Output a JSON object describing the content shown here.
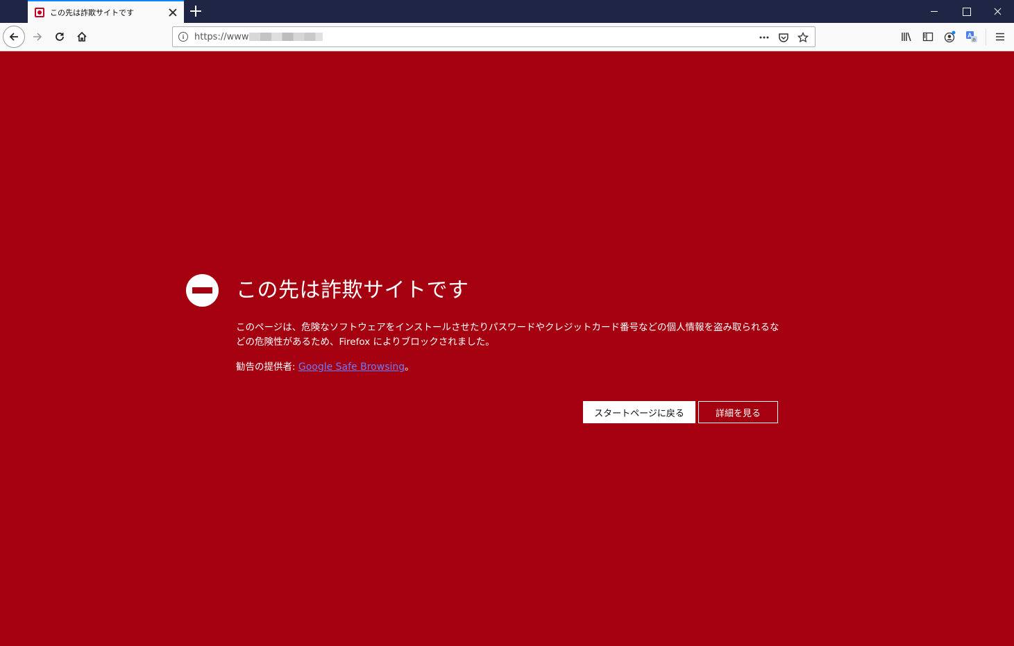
{
  "tab": {
    "title": "この先は詐欺サイトです"
  },
  "urlbar": {
    "url_visible": "https://www"
  },
  "warning": {
    "title": "この先は詐欺サイトです",
    "body": "このページは、危険なソフトウェアをインストールさせたりパスワードやクレジットカード番号などの個人情報を盗み取られるなどの危険性があるため、Firefox によりブロックされました。",
    "provider_label": "勧告の提供者: ",
    "provider_link": "Google Safe Browsing",
    "provider_suffix": "。",
    "start_button": "スタートページに戻る",
    "details_button": "詳細を見る"
  },
  "colors": {
    "background": "#a5000f",
    "titlebar": "#1f2545",
    "tab_accent": "#0a84ff",
    "link": "#6b7cff"
  }
}
